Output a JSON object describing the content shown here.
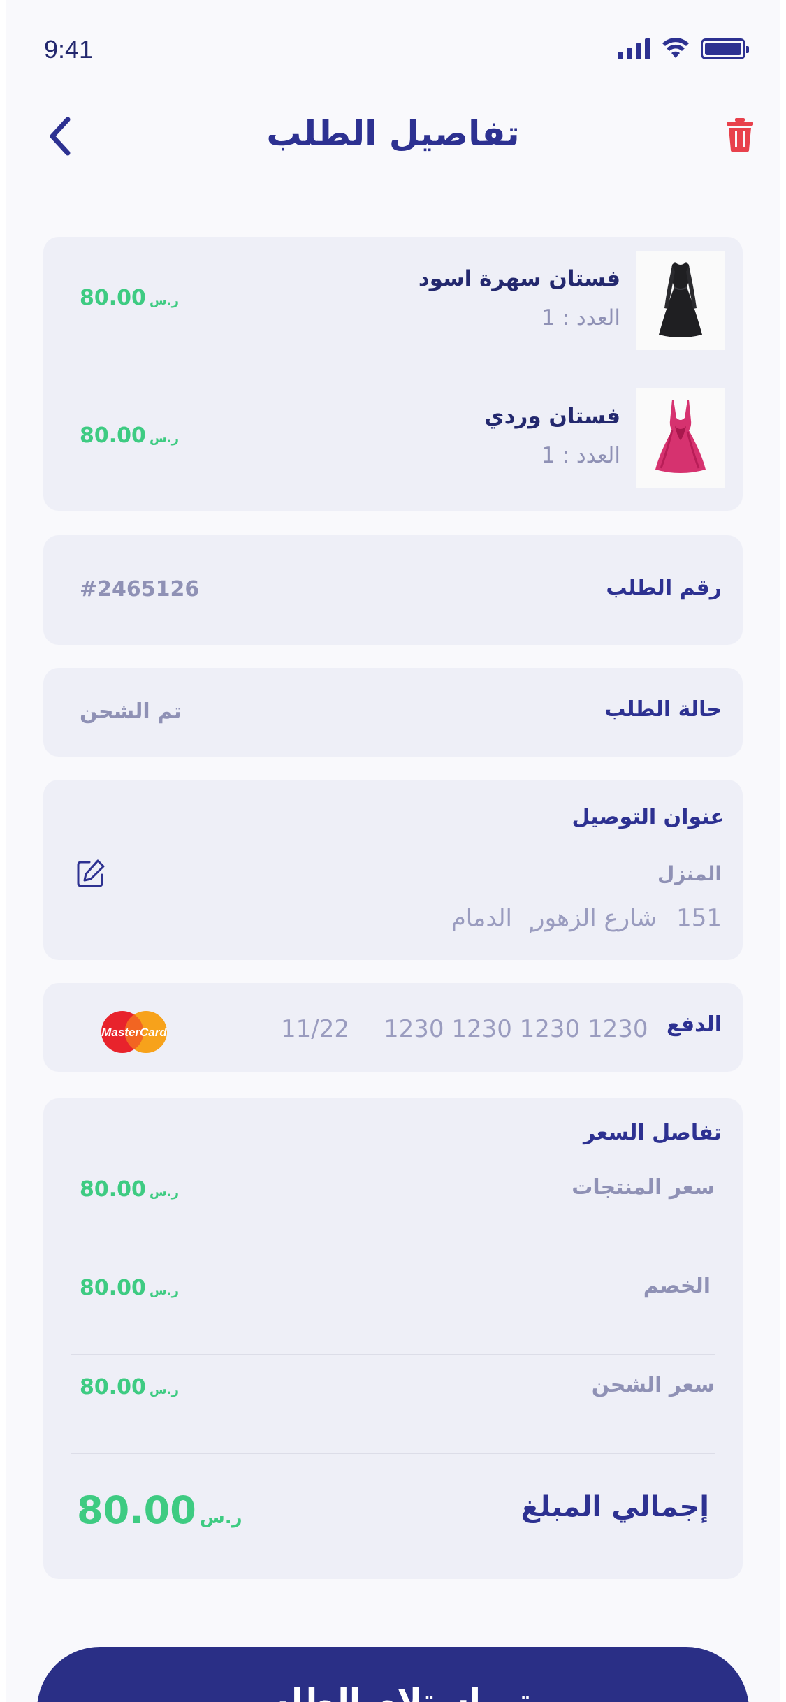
{
  "status_bar": {
    "time": "9:41"
  },
  "header": {
    "title": "تفاصيل الطلب"
  },
  "products": [
    {
      "name": "فستان سهرة اسود",
      "quantity_label": "العدد : 1",
      "price": "80.00",
      "currency": "ر.س",
      "image": "black-dress"
    },
    {
      "name": "فستان وردي",
      "quantity_label": "العدد : 1",
      "price": "80.00",
      "currency": "ر.س",
      "image": "pink-dress"
    }
  ],
  "order_number": {
    "label": "رقم الطلب",
    "value": "#2465126"
  },
  "order_status": {
    "label": "حالة الطلب",
    "value": "تم الشحن"
  },
  "address": {
    "title": "عنوان التوصيل",
    "type": "المنزل",
    "number": "151",
    "street": "شارع الزهور",
    "separator": ",",
    "city": "الدمام"
  },
  "payment": {
    "label": "الدفع",
    "card_number": "1230 1230 1230 1230",
    "expiry": "11/22",
    "brand": "MasterCard"
  },
  "price_details": {
    "title": "تفاصل السعر",
    "rows": [
      {
        "label": "سعر المنتجات",
        "value": "80.00",
        "currency": "ر.س"
      },
      {
        "label": "الخصم",
        "value": "80.00",
        "currency": "ر.س"
      },
      {
        "label": "سعر الشحن",
        "value": "80.00",
        "currency": "ر.س"
      }
    ],
    "total_label": "إجمالي المبلغ",
    "total_value": "80.00",
    "total_currency": "ر.س"
  },
  "cta": {
    "label": "تم استلام الطلب"
  },
  "colors": {
    "primary": "#2d3191",
    "accent_green": "#3ecb82",
    "danger": "#e8414c",
    "card_bg": "#eeeff7",
    "muted": "#8f91b5"
  },
  "icons": {
    "back": "chevron-left-icon",
    "delete": "trash-icon",
    "edit": "edit-icon",
    "card_brand": "mastercard-icon"
  }
}
